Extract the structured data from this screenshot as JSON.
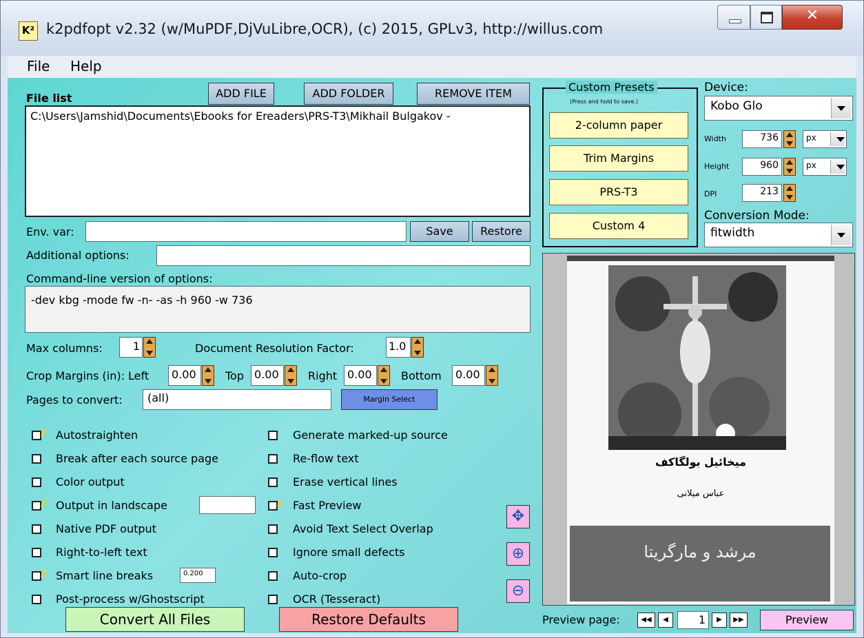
{
  "window": {
    "title": "k2pdfopt v2.32 (w/MuPDF,DjVuLibre,OCR), (c) 2015, GPLv3, http://willus.com",
    "icon_text": "K²",
    "controls": [
      "minimize-icon",
      "maximize-icon",
      "close-icon"
    ]
  },
  "menu": {
    "file": "File",
    "help": "Help"
  },
  "file_list": {
    "label": "File list",
    "add_file": "ADD FILE",
    "add_folder": "ADD FOLDER",
    "remove_item": "REMOVE ITEM",
    "items": [
      "C:\\Users\\Jamshid\\Documents\\Ebooks for Ereaders\\PRS-T3\\Mikhail Bulgakov -"
    ]
  },
  "env": {
    "label": "Env. var:",
    "value": "",
    "save": "Save",
    "restore": "Restore"
  },
  "additional": {
    "label": "Additional options:",
    "value": ""
  },
  "cmdline": {
    "label": "Command-line version of options:",
    "value": "-dev kbg -mode fw -n- -as -h 960 -w 736"
  },
  "max_columns": {
    "label": "Max columns:",
    "value": "1"
  },
  "doc_res": {
    "label": "Document Resolution Factor:",
    "value": "1.0"
  },
  "crop": {
    "label": "Crop Margins (in): Left",
    "left": "0.00",
    "top_label": "Top",
    "top": "0.00",
    "right_label": "Right",
    "right": "0.00",
    "bottom_label": "Bottom",
    "bottom": "0.00"
  },
  "pages": {
    "label": "Pages to convert:",
    "value": "(all)",
    "margin_select": "Margin Select"
  },
  "options_left": [
    {
      "label": "Autostraighten",
      "checked": true
    },
    {
      "label": "Break after each source page",
      "checked": false
    },
    {
      "label": "Color output",
      "checked": false
    },
    {
      "label": "Output in landscape",
      "checked": true
    },
    {
      "label": "Native PDF output",
      "checked": false
    },
    {
      "label": "Right-to-left text",
      "checked": false
    },
    {
      "label": "Smart line breaks",
      "checked": true
    },
    {
      "label": "Post-process w/Ghostscript",
      "checked": false
    }
  ],
  "landscape_value": "",
  "smart_value": "0.200",
  "options_right": [
    {
      "label": "Generate marked-up source",
      "checked": false
    },
    {
      "label": "Re-flow text",
      "checked": false
    },
    {
      "label": "Erase vertical lines",
      "checked": false
    },
    {
      "label": "Fast Preview",
      "checked": true
    },
    {
      "label": "Avoid Text Select Overlap",
      "checked": false
    },
    {
      "label": "Ignore small defects",
      "checked": false
    },
    {
      "label": "Auto-crop",
      "checked": false
    },
    {
      "label": "OCR (Tesseract)",
      "checked": false
    }
  ],
  "actions": {
    "convert": "Convert All Files",
    "restore_defaults": "Restore Defaults"
  },
  "presets": {
    "title": "Custom Presets",
    "hint": "(Press and hold to save.)",
    "items": [
      "2-column paper",
      "Trim Margins",
      "PRS-T3",
      "Custom 4"
    ]
  },
  "device": {
    "label": "Device:",
    "value": "Kobo Glo",
    "width_label": "Width",
    "width": "736",
    "width_unit": "px",
    "height_label": "Height",
    "height": "960",
    "height_unit": "px",
    "dpi_label": "DPI",
    "dpi": "213",
    "mode_label": "Conversion Mode:",
    "mode": "fitwidth"
  },
  "preview_image": {
    "title_line": "میخائیل بولگاکف",
    "author_line": "عباس میلانی",
    "band_text": "مرشد و مارگریتا"
  },
  "preview_tools": [
    "move-icon",
    "zoom-in-icon",
    "zoom-out-icon"
  ],
  "preview_nav": {
    "label": "Preview page:",
    "page": "1",
    "preview": "Preview"
  }
}
